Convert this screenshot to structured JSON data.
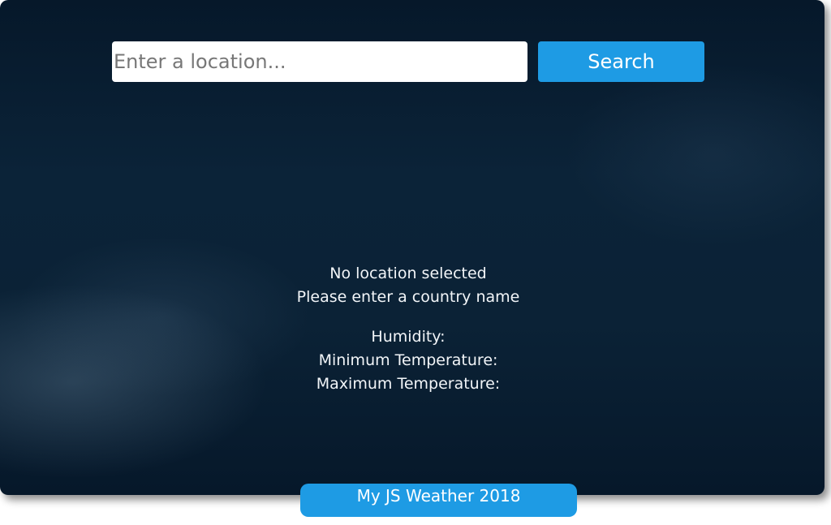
{
  "search": {
    "placeholder": "Enter a location...",
    "value": "",
    "button_label": "Search"
  },
  "weather": {
    "location_status": "No location selected",
    "hint": "Please enter a country name",
    "humidity_label": "Humidity:",
    "min_temp_label": "Minimum Temperature:",
    "max_temp_label": "Maximum Temperature:"
  },
  "footer": {
    "label": "My JS Weather 2018"
  },
  "colors": {
    "accent": "#1e9be4",
    "background_dark": "#0b2338",
    "text": "#f2f5f8"
  }
}
